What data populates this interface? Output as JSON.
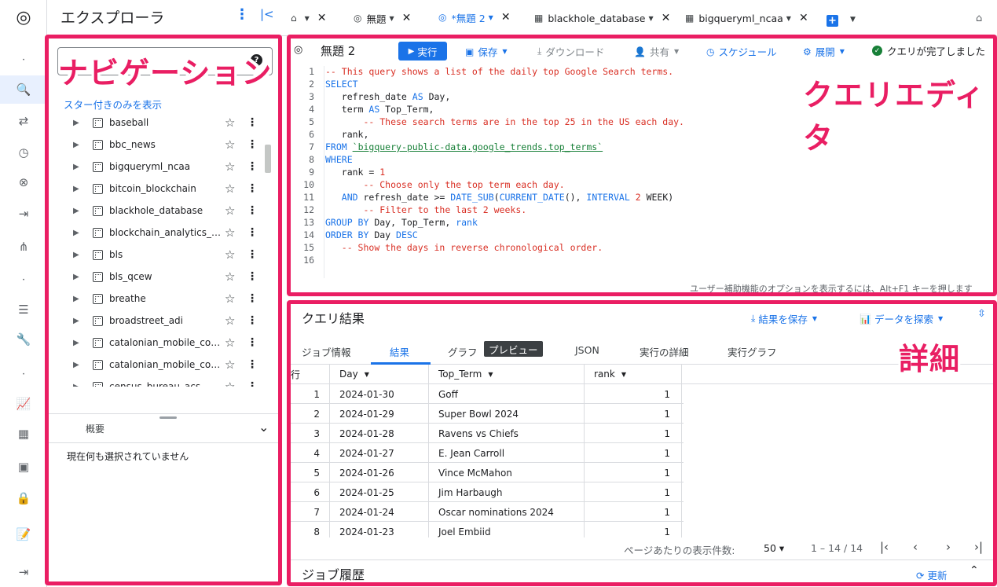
{
  "rail": {
    "items": [
      {
        "name": "bigquery-logo-icon",
        "glyph": "◎"
      },
      {
        "name": "dot-icon",
        "glyph": "•"
      },
      {
        "name": "search-icon",
        "glyph": "🔍"
      },
      {
        "name": "transfer-icon",
        "glyph": "⇄"
      },
      {
        "name": "history-icon",
        "glyph": "◷"
      },
      {
        "name": "analytics-hub-icon",
        "glyph": "⊗"
      },
      {
        "name": "pipeline-icon",
        "glyph": "⇥"
      },
      {
        "name": "graph-icon",
        "glyph": "⋔"
      },
      {
        "name": "dot-icon",
        "glyph": "•"
      },
      {
        "name": "list-icon",
        "glyph": "☰"
      },
      {
        "name": "wrench-icon",
        "glyph": "🔧"
      },
      {
        "name": "dot-icon",
        "glyph": "•"
      },
      {
        "name": "chart-icon",
        "glyph": "📈"
      },
      {
        "name": "dashboard-icon",
        "glyph": "▦"
      },
      {
        "name": "table-icon",
        "glyph": "▣"
      },
      {
        "name": "lock-icon",
        "glyph": "🔒"
      },
      {
        "name": "release-notes-icon",
        "glyph": "📝"
      },
      {
        "name": "expand-rail-icon",
        "glyph": "⇥"
      }
    ]
  },
  "explorer": {
    "title": "エクスプローラ",
    "more_glyph": "⋮",
    "collapse_glyph": "|<",
    "help_glyph": "?",
    "star_link": "スター付きのみを表示",
    "datasets": [
      "baseball",
      "bbc_news",
      "bigqueryml_ncaa",
      "bitcoin_blockchain",
      "blackhole_database",
      "blockchain_analytics_et...",
      "bls",
      "bls_qcew",
      "breathe",
      "broadstreet_adi",
      "catalonian_mobile_cover...",
      "catalonian_mobile_cover...",
      "census_bureau_acs"
    ],
    "summary_label": "概要",
    "nothing_selected": "現在何も選択されていません"
  },
  "tabs": [
    {
      "icon": "⌂",
      "label": "",
      "active": false
    },
    {
      "icon": "◎",
      "label": "無題",
      "active": false
    },
    {
      "icon": "◎",
      "label": "*無題 2",
      "active": true
    },
    {
      "icon": "▦",
      "label": "blackhole_database",
      "active": false
    },
    {
      "icon": "▦",
      "label": "bigqueryml_ncaa",
      "active": false
    }
  ],
  "editor": {
    "title": "無題 2",
    "run_label": "実行",
    "save_label": "保存",
    "download_label": "ダウンロード",
    "share_label": "共有",
    "schedule_label": "スケジュール",
    "deploy_label": "展開",
    "status": "クエリが完了しました",
    "a11y_hint": "ユーザー補助機能のオプションを表示するには、Alt+F1 キーを押します",
    "lines": [
      "<span class=\"cm\">-- This query shows a list of the daily top Google Search terms.</span>",
      "<span class=\"kw\">SELECT</span>",
      "   refresh_date <span class=\"kw\">AS</span> Day,",
      "   term <span class=\"kw\">AS</span> Top_Term,",
      "       <span class=\"cm\">-- These search terms are in the top 25 in the US each day.</span>",
      "   rank,",
      "<span class=\"kw\">FROM</span> <span class=\"st\">`bigquery-public-data.google_trends.top_terms`</span>",
      "<span class=\"kw\">WHERE</span>",
      "   rank = <span class=\"nm\">1</span>",
      "       <span class=\"cm\">-- Choose only the top term each day.</span>",
      "   <span class=\"kw\">AND</span> refresh_date &gt;= <span class=\"kw\">DATE_SUB</span>(<span class=\"kw\">CURRENT_DATE</span>(), <span class=\"kw\">INTERVAL</span> <span class=\"nm\">2</span> WEEK)",
      "       <span class=\"cm\">-- Filter to the last 2 weeks.</span>",
      "<span class=\"kw\">GROUP BY</span> Day, Top_Term, <span class=\"kw\">rank</span>",
      "<span class=\"kw\">ORDER BY</span> Day <span class=\"kw\">DESC</span>",
      "   <span class=\"cm\">-- Show the days in reverse chronological order.</span>",
      ""
    ]
  },
  "results": {
    "title": "クエリ結果",
    "save_results": "結果を保存",
    "explore_data": "データを探索",
    "tabs": [
      "ジョブ情報",
      "結果",
      "グラフ",
      "JSON",
      "実行の詳細",
      "実行グラフ"
    ],
    "preview_chip": "プレビュー",
    "columns": [
      "行",
      "Day",
      "Top_Term",
      "rank"
    ],
    "rows": [
      [
        "1",
        "2024-01-30",
        "Goff",
        "1"
      ],
      [
        "2",
        "2024-01-29",
        "Super Bowl 2024",
        "1"
      ],
      [
        "3",
        "2024-01-28",
        "Ravens vs Chiefs",
        "1"
      ],
      [
        "4",
        "2024-01-27",
        "E. Jean Carroll",
        "1"
      ],
      [
        "5",
        "2024-01-26",
        "Vince McMahon",
        "1"
      ],
      [
        "6",
        "2024-01-25",
        "Jim Harbaugh",
        "1"
      ],
      [
        "7",
        "2024-01-24",
        "Oscar nominations 2024",
        "1"
      ],
      [
        "8",
        "2024-01-23",
        "Joel Embiid",
        "1"
      ]
    ],
    "per_page_label": "ページあたりの表示件数:",
    "page_size": "50",
    "range": "1 – 14 / 14",
    "job_history": "ジョブ履歴",
    "refresh": "更新"
  },
  "annotations": {
    "navigation": "ナビゲーション",
    "query_editor": "クエリエディタ",
    "details": "詳細",
    "color": "#e91e63"
  }
}
